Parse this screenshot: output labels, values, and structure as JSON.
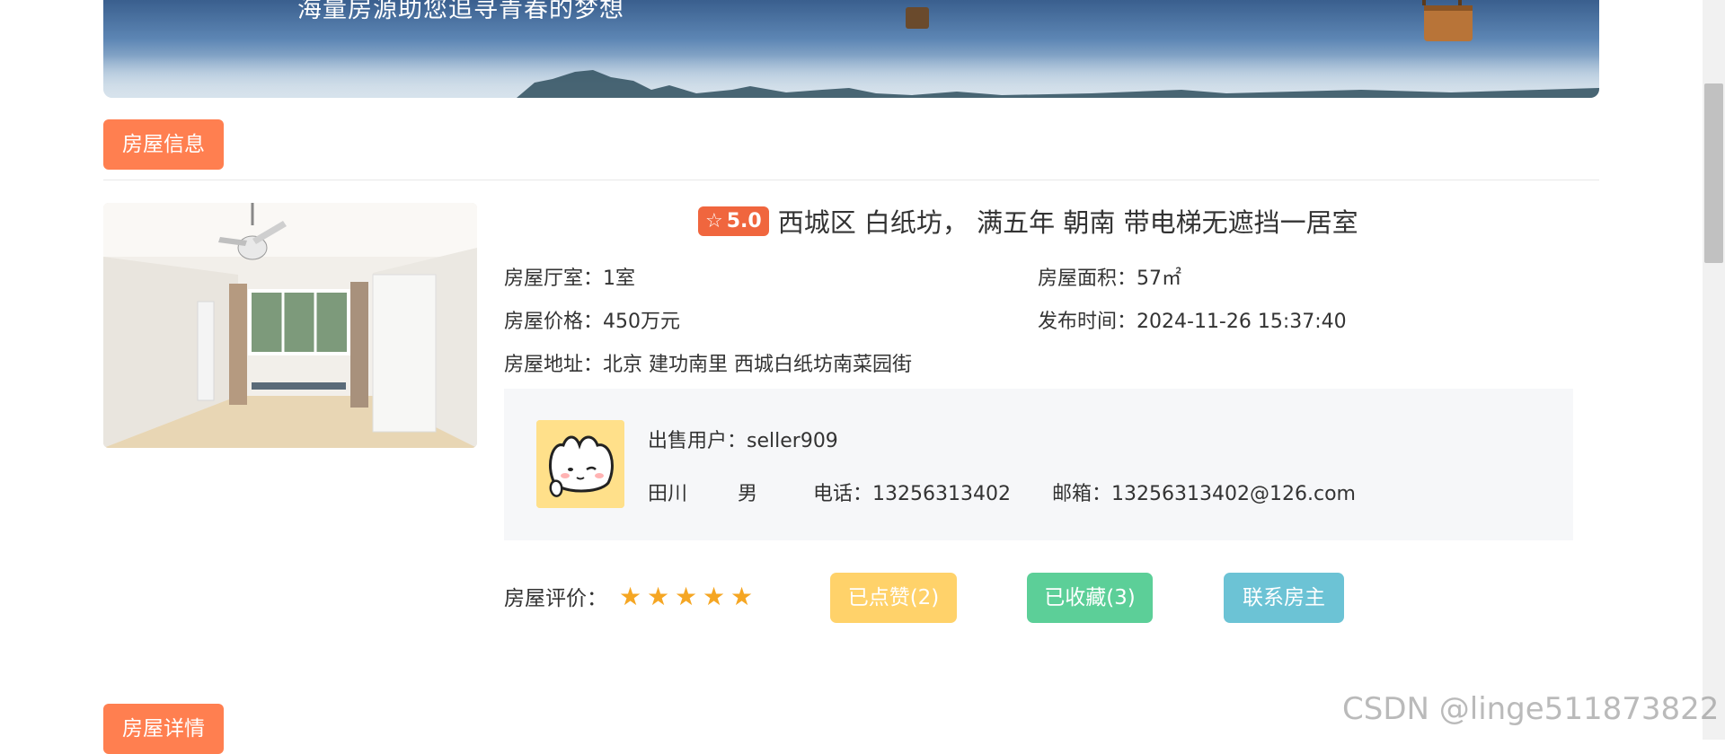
{
  "banner": {
    "slogan": "海量房源助您追寻青春的梦想"
  },
  "sections": {
    "info_tag": "房屋信息",
    "detail_tag": "房屋详情"
  },
  "house": {
    "rating": "5.0",
    "title": "西城区 白纸坊， 满五年 朝南 带电梯无遮挡一居室",
    "layout_label": "房屋厅室：",
    "layout_value": "1室",
    "area_label": "房屋面积：",
    "area_value": "57㎡",
    "price_label": "房屋价格：",
    "price_value": "450万元",
    "publish_label": "发布时间：",
    "publish_value": "2024-11-26 15:37:40",
    "address_label": "房屋地址：",
    "address_value": "北京 建功南里 西城白纸坊南菜园街"
  },
  "seller": {
    "user_label": "出售用户：",
    "user_value": "seller909",
    "name": "田川",
    "gender": "男",
    "phone_label": "电话：",
    "phone_value": "13256313402",
    "email_label": "邮箱：",
    "email_value": "13256313402@126.com"
  },
  "evaluation": {
    "label": "房屋评价：",
    "stars": 5,
    "star_glyph": "★"
  },
  "actions": {
    "like_label": "已点赞(2)",
    "favorite_label": "已收藏(3)",
    "contact_label": "联系房主"
  },
  "colors": {
    "tag": "#ff7f50",
    "rating_badge": "#f0663e",
    "like_button": "#ffd26a",
    "favorite_button": "#5ccf98",
    "contact_button": "#6cc3d5",
    "star": "#f5a623"
  },
  "watermark": "CSDN @linge511873822"
}
